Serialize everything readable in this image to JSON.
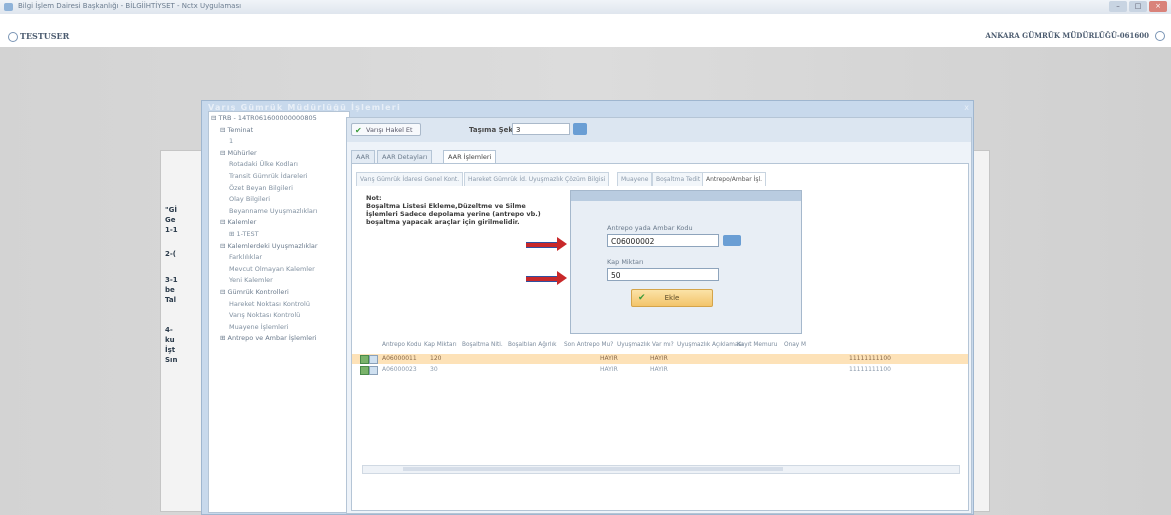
{
  "window": {
    "title": "Bilgi İşlem Dairesi Başkanlığı - BİLGİİHTİYSET - Nctx Uygulaması"
  },
  "window_controls": [
    "–",
    "□",
    "×"
  ],
  "user": {
    "name": "TESTUSER",
    "office": "ANKARA GÜMRÜK MÜDÜRLÜĞÜ-061600"
  },
  "background_labels": [
    "\"Gİ",
    "Ge",
    "1-1",
    "2-(",
    "3-1",
    "be",
    "Tal",
    "4-",
    "ku",
    "İşt",
    "Sın"
  ],
  "dialog": {
    "title": "Varış Gümrük Müdürlüğü İşlemleri",
    "tree": [
      {
        "label": "⊟ TRB - 14TR061600000000805",
        "level": 0
      },
      {
        "label": "⊟ Teminat",
        "level": 1
      },
      {
        "label": "1",
        "level": 2
      },
      {
        "label": "⊟ Mühürler",
        "level": 1
      },
      {
        "label": "Rotadaki Ülke Kodları",
        "level": 2
      },
      {
        "label": "Transit Gümrük İdareleri",
        "level": 2
      },
      {
        "label": "Özet Beyan Bilgileri",
        "level": 2
      },
      {
        "label": "Olay Bilgileri",
        "level": 2
      },
      {
        "label": "Beyanname Uyuşmazlıkları",
        "level": 2
      },
      {
        "label": "⊟ Kalemler",
        "level": 1
      },
      {
        "label": "⊞ 1-TEST",
        "level": 2
      },
      {
        "label": "⊟ Kalemlerdeki Uyuşmazlıklar",
        "level": 1
      },
      {
        "label": "Farklılıklar",
        "level": 2
      },
      {
        "label": "Mevcut Olmayan Kalemler",
        "level": 2
      },
      {
        "label": "Yeni Kalemler",
        "level": 2
      },
      {
        "label": "⊟ Gümrük Kontrolleri",
        "level": 1
      },
      {
        "label": "Hareket Noktası Kontrolü",
        "level": 2
      },
      {
        "label": "Varış Noktası Kontrolü",
        "level": 2
      },
      {
        "label": "Muayene İşlemleri",
        "level": 2
      },
      {
        "label": "⊞ Antrepo ve Ambar İşlemleri",
        "level": 1
      }
    ],
    "nakil_button": "Varışı Hakel Et",
    "tasima_label": "Taşıma Şekli",
    "tasima_value": "3",
    "tabs": [
      "AAR",
      "AAR Detayları",
      "AAR İşlemleri"
    ],
    "active_tab": 2,
    "subtabs": [
      "Varış Gümrük İdaresi Genel Kont.",
      "Hareket Gümrük İd. Uyuşmazlık Çözüm Bilgisi",
      "Muayene",
      "Boşaltma Tedit",
      "Antrepo/Ambar İşl."
    ],
    "active_subtab": 4,
    "note": {
      "heading": "Not:",
      "lines": [
        "Boşaltma Listesi Ekleme,Düzeltme ve Silme",
        "İşlemleri Sadece depolama yerine (antrepo vb.)",
        "boşaltma yapacak araçlar için girilmelidir."
      ]
    },
    "modal": {
      "antrepo_label": "Antrepo yada Ambar Kodu",
      "antrepo_value": "C06000002",
      "kap_label": "Kap Miktarı",
      "kap_value": "50",
      "ekle_label": "Ekle"
    },
    "grid": {
      "columns": [
        "Antrepo Kodu",
        "Kap Miktarı",
        "Boşaltma Niti.",
        "Boşaltılan Ağırlık",
        "Son Antrepo Mu?",
        "Uyuşmazlık Var mı?",
        "Uyuşmazlık Açıklaması",
        "Kayıt Memuru",
        "Onay M"
      ],
      "rows": [
        {
          "antrepo": "A06000011",
          "kap": "120",
          "son": "HAYIR",
          "uyusmazlik": "HAYIR",
          "kayit": "11111111100"
        },
        {
          "antrepo": "A06000023",
          "kap": "30",
          "son": "HAYIR",
          "uyusmazlik": "HAYIR",
          "kayit": "11111111100"
        }
      ],
      "selected_row": 0
    }
  },
  "colors": {
    "arrow": "#c8282a",
    "selected_row": "#fde2b8",
    "accent": "#6a9ed4"
  }
}
